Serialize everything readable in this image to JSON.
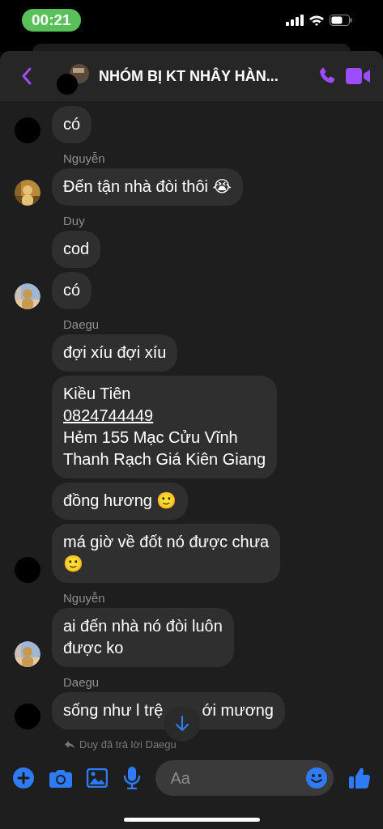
{
  "status_bar": {
    "time": "00:21"
  },
  "header": {
    "title": "NHÓM BỊ KT NHÂY HÀN..."
  },
  "groups": [
    {
      "avatar": {
        "kind": "redacted"
      },
      "bubbles": [
        {
          "kind": "lines",
          "texts": [
            {
              "text": "có",
              "link": false
            }
          ]
        }
      ]
    },
    {
      "sender": "Nguyễn",
      "avatar": {
        "kind": "picture"
      },
      "bubbles": [
        {
          "kind": "lines",
          "texts": [
            {
              "text": "Đến tận nhà đòi thôi 😭",
              "link": false
            }
          ]
        }
      ]
    },
    {
      "sender": "Duy",
      "avatar": {
        "kind": "picture"
      },
      "bubbles": [
        {
          "kind": "lines",
          "texts": [
            {
              "text": "cod",
              "link": false
            }
          ]
        },
        {
          "kind": "lines",
          "texts": [
            {
              "text": "có",
              "link": false
            }
          ]
        }
      ]
    },
    {
      "sender": "Daegu",
      "avatar": {
        "kind": "redacted"
      },
      "bubbles": [
        {
          "kind": "lines",
          "texts": [
            {
              "text": "đợi xíu đợi xíu",
              "link": false
            }
          ]
        },
        {
          "kind": "lines",
          "texts": [
            {
              "text": "Kiều Tiên",
              "link": false
            },
            {
              "text": "0824744449",
              "link": true
            },
            {
              "text": "Hẻm 155 Mạc Cửu Vĩnh",
              "link": false
            },
            {
              "text": "Thanh Rạch Giá Kiên Giang",
              "link": false
            }
          ]
        },
        {
          "kind": "lines",
          "texts": [
            {
              "text": "đồng hương 🙂",
              "link": false
            }
          ]
        },
        {
          "kind": "lines",
          "texts": [
            {
              "text": "má giờ về đốt nó được chưa",
              "link": false
            },
            {
              "text": "🙂",
              "link": false
            }
          ]
        }
      ]
    },
    {
      "sender": "Nguyễn",
      "avatar": {
        "kind": "picture"
      },
      "bubbles": [
        {
          "kind": "lines",
          "texts": [
            {
              "text": "ai đến nhà nó đòi luôn",
              "link": false
            },
            {
              "text": "được ko",
              "link": false
            }
          ]
        }
      ]
    },
    {
      "sender": "Daegu",
      "avatar": {
        "kind": "redacted"
      },
      "bubbles": [
        {
          "kind": "covered",
          "texts": [
            {
              "text": "sống như l trệ",
              "link": false
            },
            {
              "text": "ới mương",
              "link": false
            }
          ]
        }
      ]
    }
  ],
  "reply_notice": "Duy đã trả lời Daegu",
  "composer": {
    "placeholder": "Aa"
  }
}
